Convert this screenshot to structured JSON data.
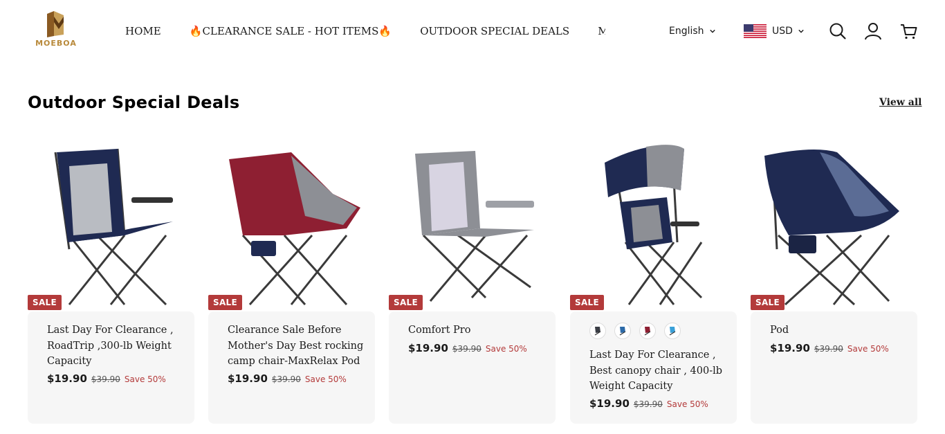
{
  "header": {
    "logo_text": "MOEBOA",
    "nav": [
      {
        "label": "HOME"
      },
      {
        "label": "🔥CLEARANCE SALE - HOT ITEMS🔥"
      },
      {
        "label": "OUTDOOR SPECIAL DEALS"
      },
      {
        "label": "MORE LINKS"
      }
    ],
    "language": "English",
    "currency": "USD",
    "icons": [
      "search-icon",
      "account-icon",
      "cart-icon",
      "us-flag-icon",
      "chevron-down-icon"
    ]
  },
  "section": {
    "title": "Outdoor Special Deals",
    "view_all": "View all"
  },
  "colors": {
    "sale_badge": "#b33a3a",
    "card_bg": "#f6f6f6",
    "logo": "#b8893a"
  },
  "products": [
    {
      "badge": "SALE",
      "title": "Last Day For Clearance , RoadTrip ,300-lb Weight Capacity",
      "price": "$19.90",
      "compare_price": "$39.90",
      "save": "Save 50%",
      "chair_colors": [
        "#1f2a52",
        "#b9bcc2"
      ]
    },
    {
      "badge": "SALE",
      "title": "Clearance Sale Before Mother's Day Best rocking camp chair-MaxRelax Pod",
      "price": "$19.90",
      "compare_price": "$39.90",
      "save": "Save 50%",
      "chair_colors": [
        "#8e1f32",
        "#8d8f95"
      ]
    },
    {
      "badge": "SALE",
      "title": "Comfort Pro",
      "price": "$19.90",
      "compare_price": "$39.90",
      "save": "Save 50%",
      "chair_colors": [
        "#8d8f95",
        "#d8d4e2"
      ]
    },
    {
      "badge": "SALE",
      "title": "Last Day For Clearance , Best canopy chair , 400-lb Weight Capacity",
      "price": "$19.90",
      "compare_price": "$39.90",
      "save": "Save 50%",
      "chair_colors": [
        "#1f2a52",
        "#8d8f95"
      ],
      "swatch_colors": [
        "#3a3d45",
        "#2c6aa8",
        "#8e1f32",
        "#3aa0d8"
      ]
    },
    {
      "badge": "SALE",
      "title": "Pod",
      "price": "$19.90",
      "compare_price": "$39.90",
      "save": "Save 50%",
      "chair_colors": [
        "#1f2a52",
        "#5b6c95"
      ]
    }
  ]
}
